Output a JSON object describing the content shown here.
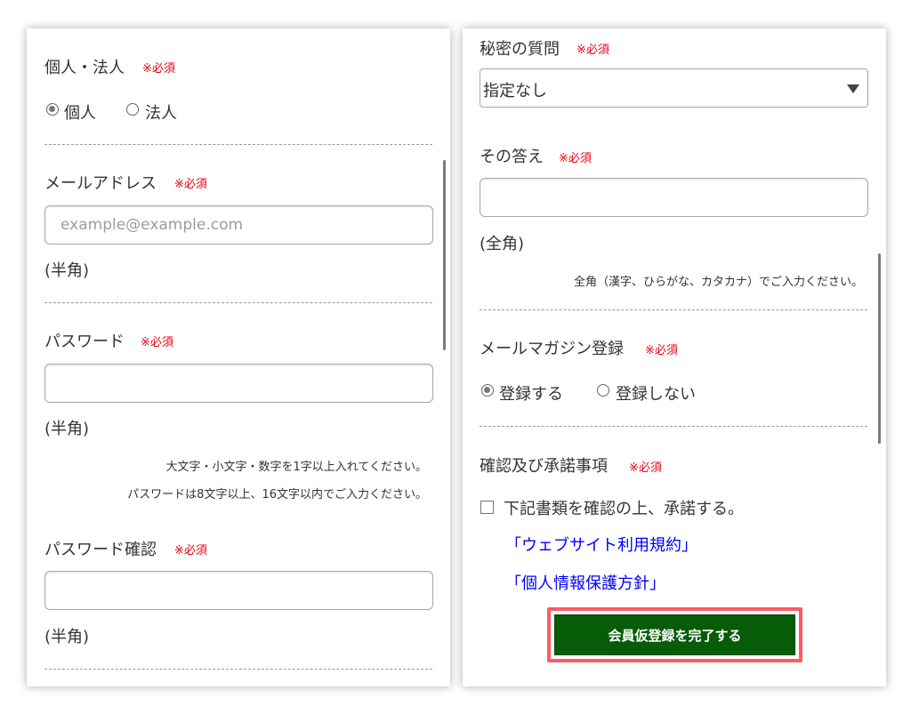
{
  "left_panel": {
    "entity_type": {
      "label": "個人・法人",
      "required": "※必須",
      "options": [
        {
          "label": "個人",
          "selected": true
        },
        {
          "label": "法人",
          "selected": false
        }
      ]
    },
    "email": {
      "label": "メールアドレス",
      "required": "※必須",
      "placeholder": "example@example.com",
      "value": "",
      "note": "(半角)"
    },
    "password": {
      "label": "パスワード",
      "required": "※必須",
      "value": "",
      "note": "(半角)",
      "hint_1": "大文字・小文字・数字を1字以上入れてください。",
      "hint_2": "パスワードは8文字以上、16文字以内でご入力ください。"
    },
    "password_confirm": {
      "label": "パスワード確認",
      "required": "※必須",
      "value": "",
      "note": "(半角)"
    }
  },
  "right_panel": {
    "secret_question": {
      "label": "秘密の質問",
      "required": "※必須",
      "selected": "指定なし"
    },
    "answer": {
      "label": "その答え",
      "required": "※必須",
      "value": "",
      "note": "(全角)",
      "hint": "全角（漢字、ひらがな、カタカナ）でご入力ください。"
    },
    "newsletter": {
      "label": "メールマガジン登録",
      "required": "※必須",
      "options": [
        {
          "label": "登録する",
          "selected": true
        },
        {
          "label": "登録しない",
          "selected": false
        }
      ]
    },
    "consent": {
      "label": "確認及び承諾事項",
      "required": "※必須",
      "checkbox_label": "下記書類を確認の上、承諾する。",
      "checked": false,
      "link_terms": "「ウェブサイト利用規約」",
      "link_privacy": "「個人情報保護方針」"
    },
    "submit_label": "会員仮登録を完了する"
  },
  "colors": {
    "required": "#e60012",
    "link": "#0000ff",
    "submit_bg": "#075c07",
    "highlight_border": "#ff5a63"
  }
}
